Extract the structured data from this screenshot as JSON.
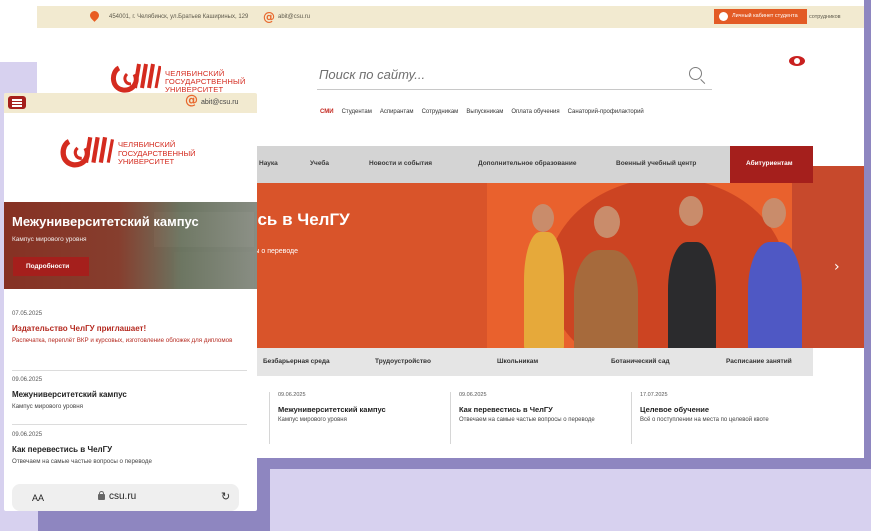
{
  "desktop": {
    "topbar": {
      "address": "454001, г. Челябинск, ул.Братьев Кашириных, 129",
      "email": "abit@csu.ru",
      "cabinet_label": "Личный кабинет студента",
      "staff_label": "сотрудников"
    },
    "logo": {
      "line1": "ЧЕЛЯБИНСКИЙ",
      "line2": "ГОСУДАРСТВЕННЫЙ",
      "line3": "УНИВЕРСИТЕТ"
    },
    "search": {
      "placeholder": "Поиск по сайту..."
    },
    "top_nav": [
      "СМИ",
      "Студентам",
      "Аспирантам",
      "Сотрудникам",
      "Выпускникам",
      "Оплата обучения",
      "Санаторий-профилакторий"
    ],
    "main_nav": [
      "Наука",
      "Учеба",
      "Новости и события",
      "Дополнительное образование",
      "Военный учебный центр",
      "Абитуриентам"
    ],
    "hero": {
      "title": "ись в ЧелГУ",
      "subtitle": "осы о переводе"
    },
    "sub_nav": [
      "Безбарьерная среда",
      "Трудоустройство",
      "Школьникам",
      "Ботанический сад",
      "Расписание занятий"
    ],
    "news": [
      {
        "date": "09.06.2025",
        "title": "Межуниверситетский кампус",
        "desc": "Кампус мирового уровня"
      },
      {
        "date": "09.06.2025",
        "title": "Как перевестись в ЧелГУ",
        "desc": "Отвечаем на самые частые вопросы о переводе"
      },
      {
        "date": "17.07.2025",
        "title": "Целевое обучение",
        "desc": "Всё о поступлении на места по целевой квоте"
      }
    ],
    "colors": {
      "accent": "#a51f1c",
      "orange": "#e35b25",
      "topbar_bg": "#f2ead0"
    }
  },
  "mobile": {
    "email": "abit@csu.ru",
    "logo": {
      "line1": "ЧЕЛЯБИНСКИЙ",
      "line2": "ГОСУДАРСТВЕННЫЙ",
      "line3": "УНИВЕРСИТЕТ"
    },
    "hero": {
      "title": "Межуниверситетский кампус",
      "subtitle": "Кампус мирового уровня",
      "button": "Подробности"
    },
    "news": [
      {
        "date": "07.05.2025",
        "title": "Издательство ЧелГУ приглашает!",
        "desc": "Распечатка, переплёт ВКР и курсовых, изготовление обложек для дипломов",
        "highlight": true
      },
      {
        "date": "09.06.2025",
        "title": "Межуниверситетский кампус",
        "desc": "Кампус мирового уровня",
        "highlight": false
      },
      {
        "date": "09.06.2025",
        "title": "Как перевестись в ЧелГУ",
        "desc": "Отвечаем на самые частые вопросы о переводе",
        "highlight": false
      }
    ],
    "browser": {
      "text_size": "AA",
      "url": "csu.ru"
    }
  },
  "icons": [
    "map-pin-icon",
    "at-icon",
    "user-icon",
    "search-icon",
    "eye-icon",
    "menu-icon",
    "lock-icon",
    "reload-icon",
    "chevron-right-icon"
  ]
}
